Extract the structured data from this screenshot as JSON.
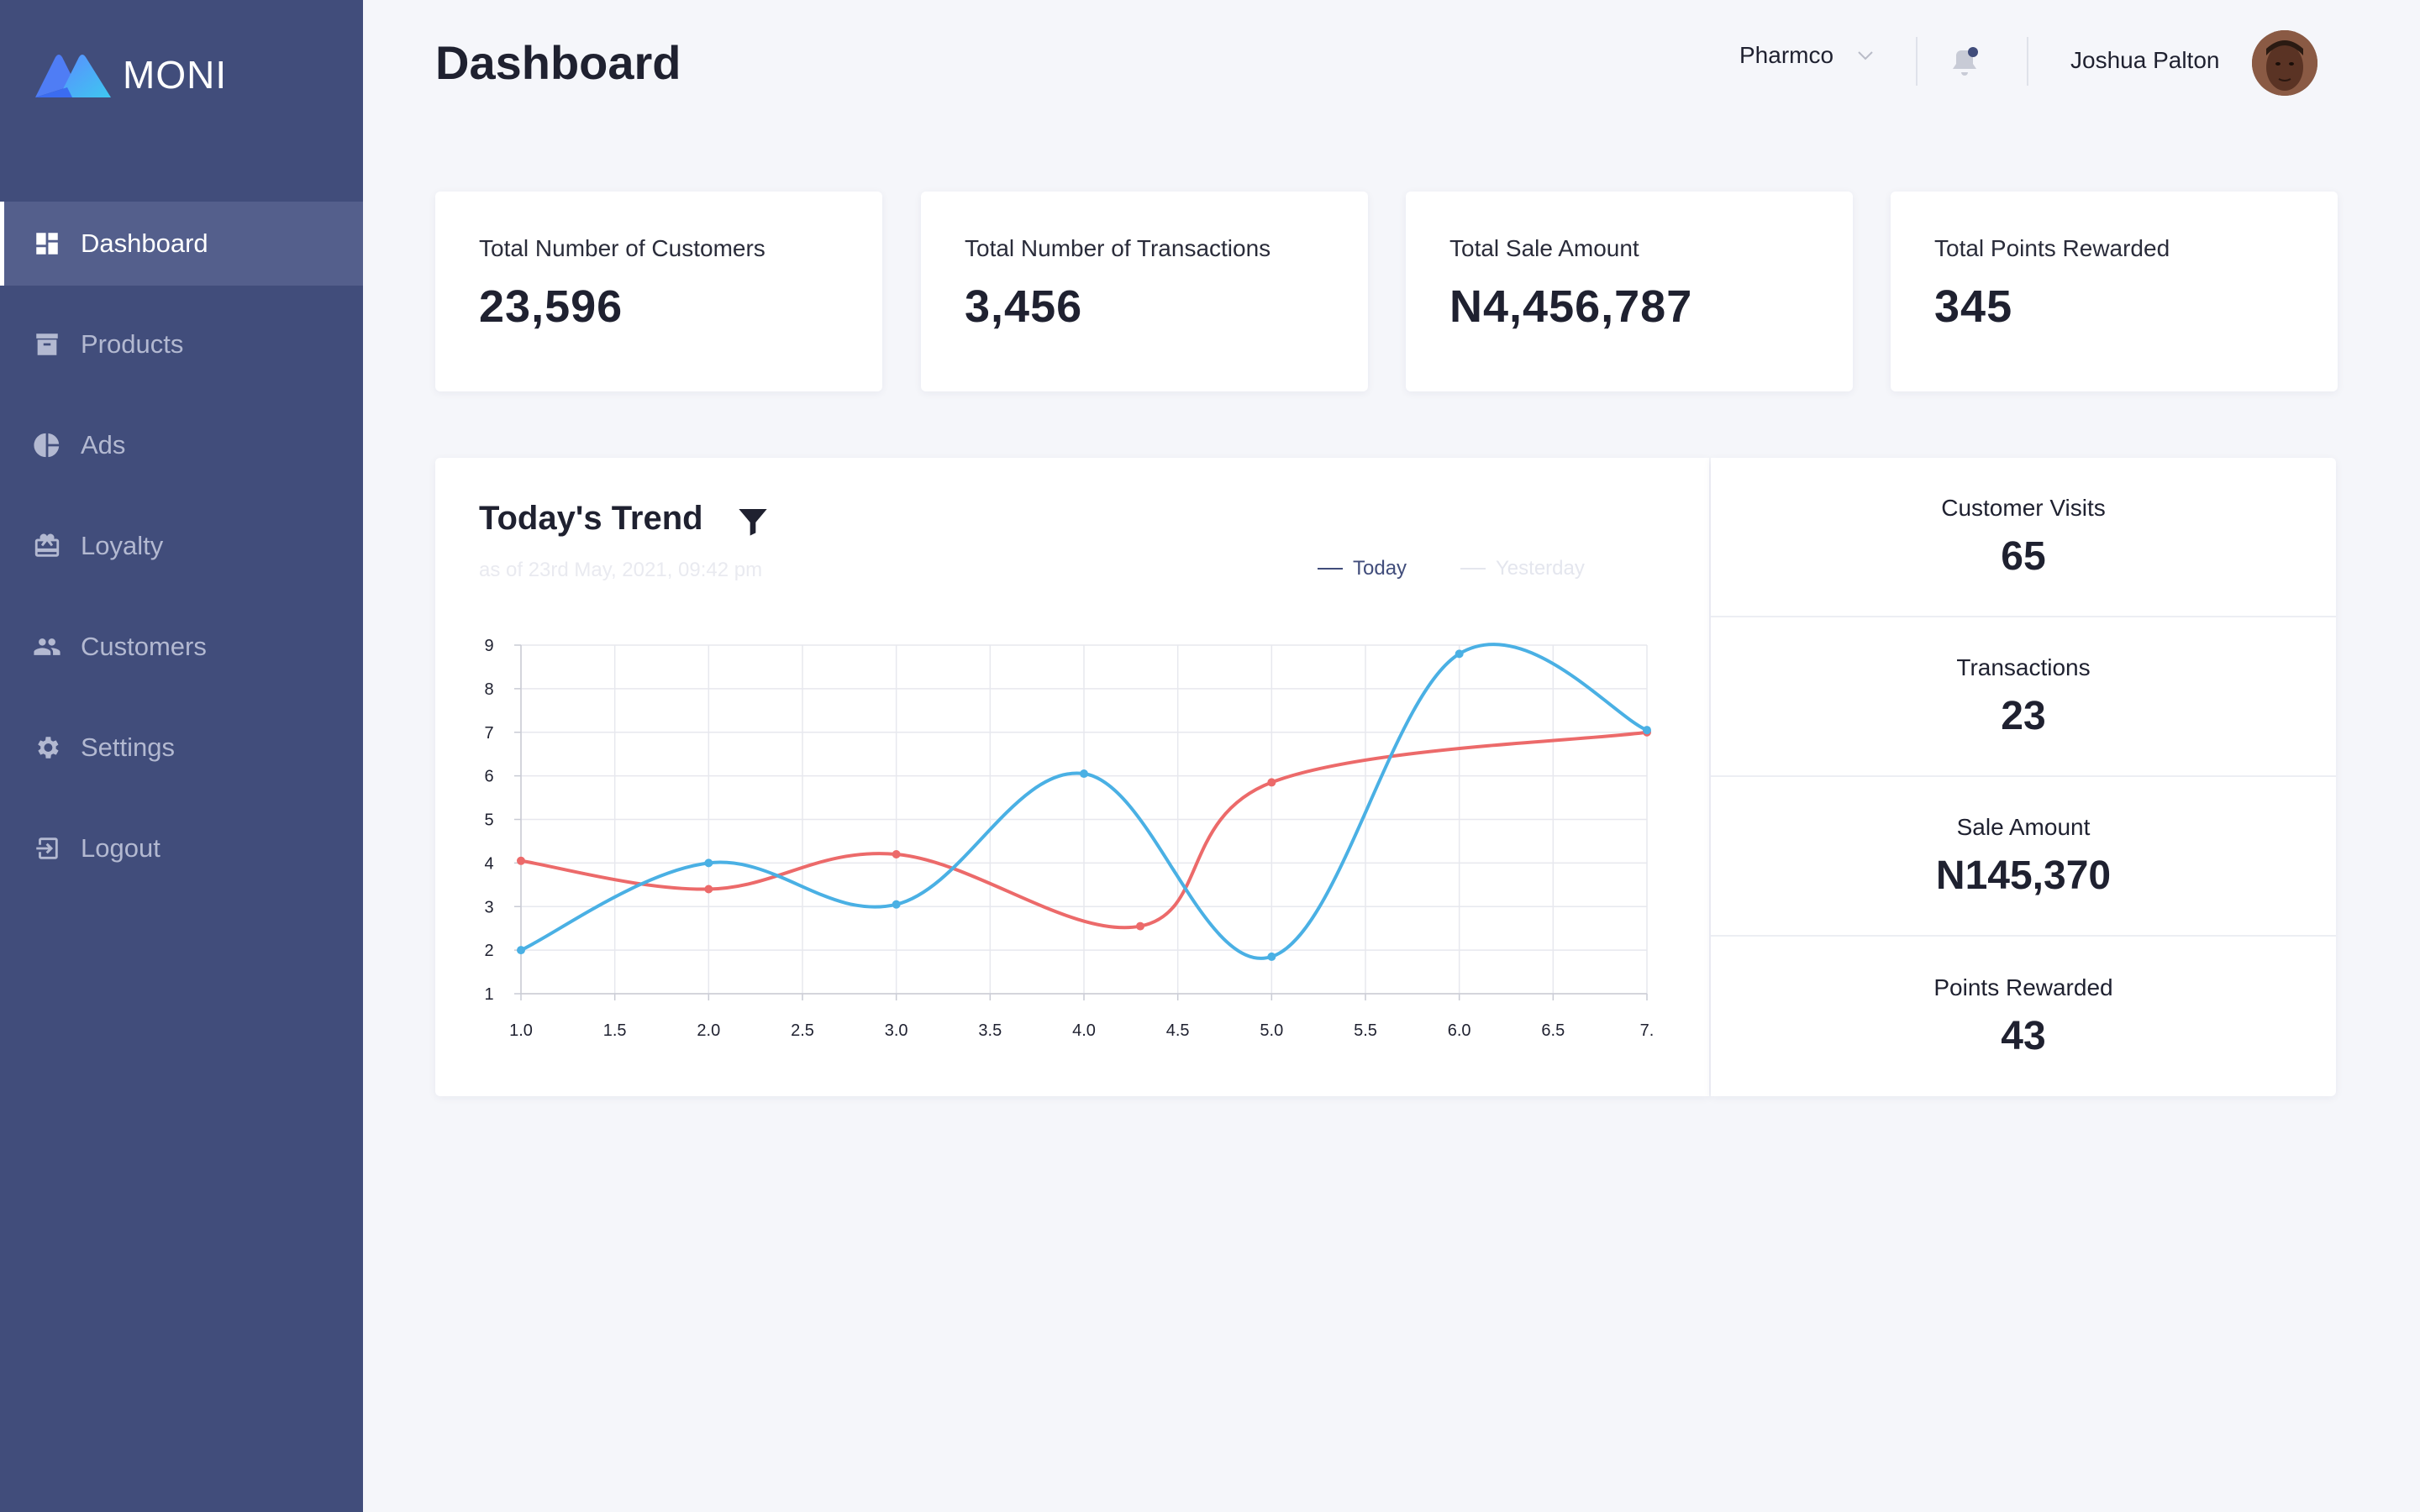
{
  "brand": {
    "name": "MONI"
  },
  "sidebar": {
    "items": [
      {
        "label": "Dashboard",
        "icon": "dashboard-icon",
        "active": true
      },
      {
        "label": "Products",
        "icon": "archive-box-icon"
      },
      {
        "label": "Ads",
        "icon": "pie-chart-icon"
      },
      {
        "label": "Loyalty",
        "icon": "gift-card-icon"
      },
      {
        "label": "Customers",
        "icon": "people-icon"
      },
      {
        "label": "Settings",
        "icon": "gear-icon"
      },
      {
        "label": "Logout",
        "icon": "logout-icon"
      }
    ]
  },
  "header": {
    "title": "Dashboard",
    "company": "Pharmco",
    "user_name": "Joshua Palton",
    "notification_dot_color": "#414d7b"
  },
  "stats": [
    {
      "label": "Total Number of Customers",
      "value": "23,596"
    },
    {
      "label": "Total Number of Transactions",
      "value": "3,456"
    },
    {
      "label": "Total Sale Amount",
      "value": "N4,456,787"
    },
    {
      "label": "Total Points Rewarded",
      "value": "345"
    }
  ],
  "trend": {
    "title": "Today's Trend",
    "as_of": "as of 23rd May, 2021, 09:42 pm",
    "legend_today": "Today",
    "legend_yesterday": "Yesterday"
  },
  "metrics": [
    {
      "label": "Customer Visits",
      "value": "65"
    },
    {
      "label": "Transactions",
      "value": "23"
    },
    {
      "label": "Sale Amount",
      "value": "N145,370"
    },
    {
      "label": "Points Rewarded",
      "value": "43"
    }
  ],
  "colors": {
    "sidebar": "#414d7b",
    "today": "#4ab0e4",
    "yesterday": "#ec6a6a"
  },
  "chart_data": {
    "type": "line",
    "title": "",
    "xlabel": "",
    "ylabel": "",
    "xlim": [
      1.0,
      7.0
    ],
    "ylim": [
      1,
      9
    ],
    "x_ticks": [
      "1.0",
      "1.5",
      "2.0",
      "2.5",
      "3.0",
      "3.5",
      "4.0",
      "4.5",
      "5.0",
      "5.5",
      "6.0",
      "6.5",
      "7."
    ],
    "y_ticks": [
      "1",
      "2",
      "3",
      "4",
      "5",
      "6",
      "7",
      "8",
      "9"
    ],
    "grid": true,
    "legend_position": "top-right",
    "series": [
      {
        "name": "Today",
        "color": "#4ab0e4",
        "x": [
          1.0,
          2.0,
          3.0,
          4.0,
          5.0,
          6.0,
          7.0
        ],
        "y": [
          2.0,
          4.0,
          3.05,
          6.05,
          1.85,
          8.8,
          7.05
        ]
      },
      {
        "name": "Yesterday",
        "color": "#ec6a6a",
        "x": [
          1.0,
          2.0,
          3.0,
          4.3,
          5.0,
          7.0
        ],
        "y": [
          4.05,
          3.4,
          4.2,
          2.55,
          5.85,
          7.0
        ]
      }
    ]
  }
}
